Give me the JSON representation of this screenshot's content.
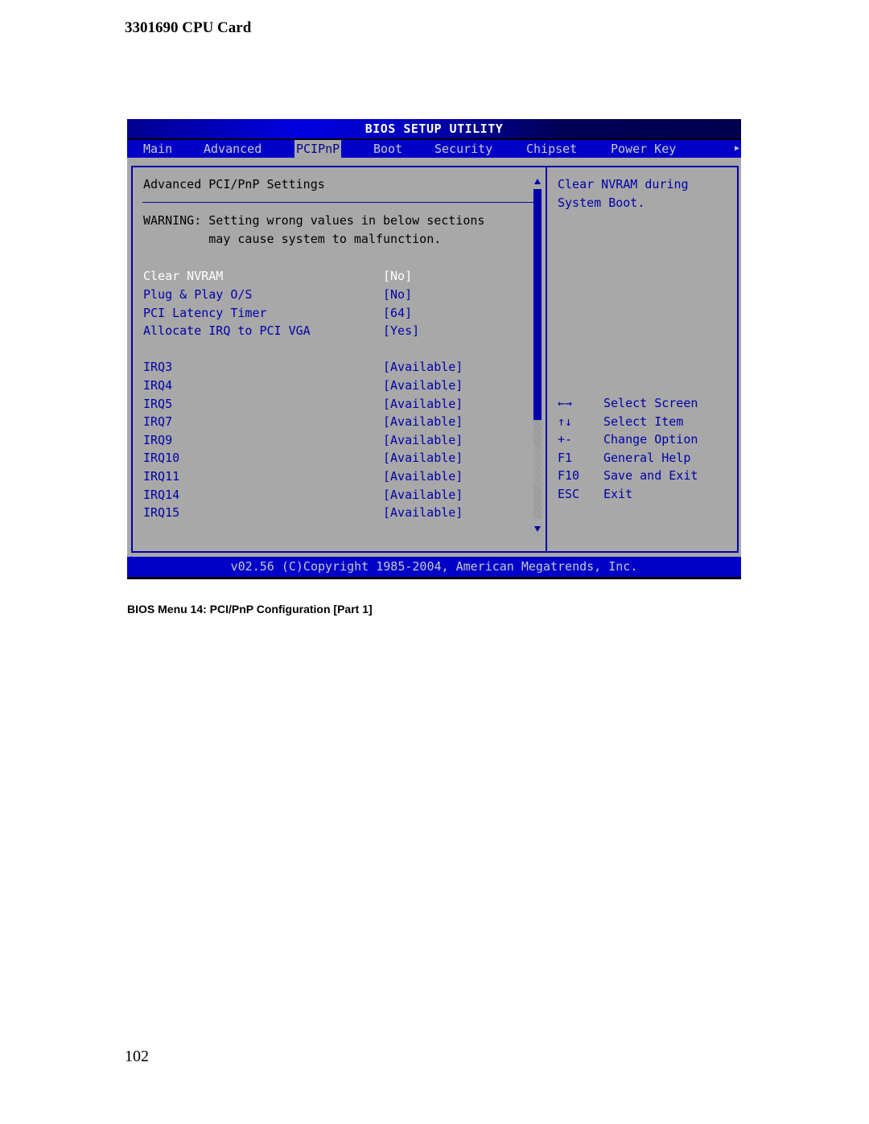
{
  "document": {
    "header": "3301690 CPU Card",
    "caption": "BIOS Menu 14: PCI/PnP Configuration [Part 1]",
    "page_number": "102"
  },
  "bios": {
    "title": "BIOS SETUP UTILITY",
    "tabs": [
      {
        "label": "Main",
        "active": false
      },
      {
        "label": "Advanced",
        "active": false
      },
      {
        "label": "PCIPnP",
        "active": true
      },
      {
        "label": "Boot",
        "active": false
      },
      {
        "label": "Security",
        "active": false
      },
      {
        "label": "Chipset",
        "active": false
      },
      {
        "label": "Power Key",
        "active": false
      }
    ],
    "more_tabs_icon": "right-triangle-icon",
    "panel_title": "Advanced PCI/PnP Settings",
    "warning": {
      "line1": "WARNING: Setting wrong values in below sections",
      "line2": "         may cause system to malfunction."
    },
    "settings": [
      {
        "label": "Clear NVRAM",
        "value": "[No]",
        "selected": true
      },
      {
        "label": "Plug & Play O/S",
        "value": "[No]",
        "selected": false
      },
      {
        "label": "PCI Latency Timer",
        "value": "[64]",
        "selected": false
      },
      {
        "label": "Allocate IRQ to PCI VGA",
        "value": "[Yes]",
        "selected": false
      }
    ],
    "irqs": [
      {
        "label": "IRQ3",
        "value": "[Available]"
      },
      {
        "label": "IRQ4",
        "value": "[Available]"
      },
      {
        "label": "IRQ5",
        "value": "[Available]"
      },
      {
        "label": "IRQ7",
        "value": "[Available]"
      },
      {
        "label": "IRQ9",
        "value": "[Available]"
      },
      {
        "label": "IRQ10",
        "value": "[Available]"
      },
      {
        "label": "IRQ11",
        "value": "[Available]"
      },
      {
        "label": "IRQ14",
        "value": "[Available]"
      },
      {
        "label": "IRQ15",
        "value": "[Available]"
      }
    ],
    "scrollbar": {
      "thumb_fraction": 0.7,
      "position_fraction": 0.0
    },
    "help": {
      "line1": "Clear NVRAM during",
      "line2": "System Boot."
    },
    "keys": [
      {
        "key": "←→",
        "desc": "Select Screen"
      },
      {
        "key": "↑↓",
        "desc": "Select Item"
      },
      {
        "key": "+-",
        "desc": "Change Option"
      },
      {
        "key": "F1",
        "desc": "General Help"
      },
      {
        "key": "F10",
        "desc": "Save and Exit"
      },
      {
        "key": "ESC",
        "desc": "Exit"
      }
    ],
    "footer": "v02.56 (C)Copyright 1985-2004, American Megatrends, Inc.",
    "colors": {
      "background": "#a8a8a8",
      "bar_blue": "#0000c8",
      "text_blue": "#0000a8",
      "selected_text": "#ffffff",
      "menu_text": "#c8c8c8"
    }
  }
}
